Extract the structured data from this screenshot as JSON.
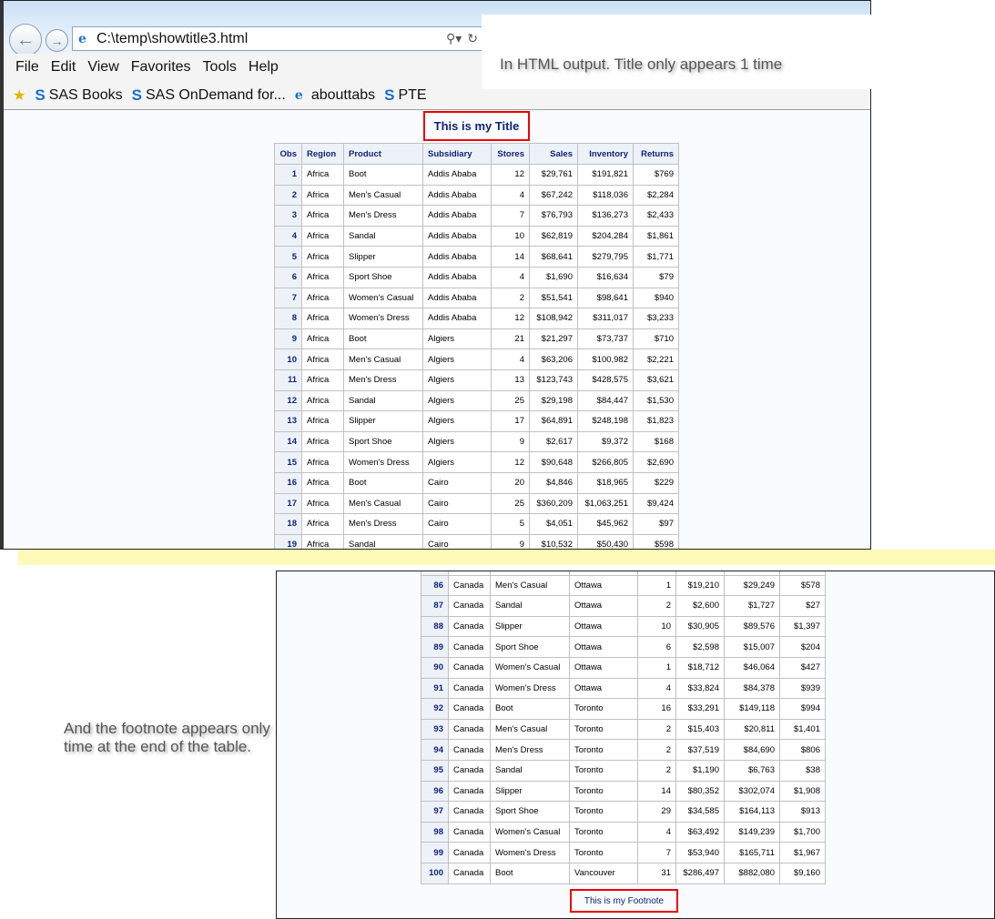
{
  "browser": {
    "address": "C:\\temp\\showtitle3.html",
    "menu": [
      "File",
      "Edit",
      "View",
      "Favorites",
      "Tools",
      "Help"
    ],
    "favorites": [
      {
        "icon": "sas-icon",
        "label": "SAS Books"
      },
      {
        "icon": "sas-icon",
        "label": "SAS OnDemand for..."
      },
      {
        "icon": "ie-page-icon",
        "label": "abouttabs"
      },
      {
        "icon": "sas-icon",
        "label": "PTE"
      }
    ]
  },
  "annotations": {
    "top": "In HTML output. Title only appears 1 time",
    "bottom": "And the footnote appears only 1 time at the end of the table."
  },
  "report": {
    "title": "This is my Title",
    "footnote": "This is my Footnote",
    "columns": [
      "Obs",
      "Region",
      "Product",
      "Subsidiary",
      "Stores",
      "Sales",
      "Inventory",
      "Returns"
    ],
    "rows_top": [
      [
        "1",
        "Africa",
        "Boot",
        "Addis Ababa",
        "12",
        "$29,761",
        "$191,821",
        "$769"
      ],
      [
        "2",
        "Africa",
        "Men's Casual",
        "Addis Ababa",
        "4",
        "$67,242",
        "$118,036",
        "$2,284"
      ],
      [
        "3",
        "Africa",
        "Men's Dress",
        "Addis Ababa",
        "7",
        "$76,793",
        "$136,273",
        "$2,433"
      ],
      [
        "4",
        "Africa",
        "Sandal",
        "Addis Ababa",
        "10",
        "$62,819",
        "$204,284",
        "$1,861"
      ],
      [
        "5",
        "Africa",
        "Slipper",
        "Addis Ababa",
        "14",
        "$68,641",
        "$279,795",
        "$1,771"
      ],
      [
        "6",
        "Africa",
        "Sport Shoe",
        "Addis Ababa",
        "4",
        "$1,690",
        "$16,634",
        "$79"
      ],
      [
        "7",
        "Africa",
        "Women's Casual",
        "Addis Ababa",
        "2",
        "$51,541",
        "$98,641",
        "$940"
      ],
      [
        "8",
        "Africa",
        "Women's Dress",
        "Addis Ababa",
        "12",
        "$108,942",
        "$311,017",
        "$3,233"
      ],
      [
        "9",
        "Africa",
        "Boot",
        "Algiers",
        "21",
        "$21,297",
        "$73,737",
        "$710"
      ],
      [
        "10",
        "Africa",
        "Men's Casual",
        "Algiers",
        "4",
        "$63,206",
        "$100,982",
        "$2,221"
      ],
      [
        "11",
        "Africa",
        "Men's Dress",
        "Algiers",
        "13",
        "$123,743",
        "$428,575",
        "$3,621"
      ],
      [
        "12",
        "Africa",
        "Sandal",
        "Algiers",
        "25",
        "$29,198",
        "$84,447",
        "$1,530"
      ],
      [
        "13",
        "Africa",
        "Slipper",
        "Algiers",
        "17",
        "$64,891",
        "$248,198",
        "$1,823"
      ],
      [
        "14",
        "Africa",
        "Sport Shoe",
        "Algiers",
        "9",
        "$2,617",
        "$9,372",
        "$168"
      ],
      [
        "15",
        "Africa",
        "Women's Dress",
        "Algiers",
        "12",
        "$90,648",
        "$266,805",
        "$2,690"
      ],
      [
        "16",
        "Africa",
        "Boot",
        "Cairo",
        "20",
        "$4,846",
        "$18,965",
        "$229"
      ],
      [
        "17",
        "Africa",
        "Men's Casual",
        "Cairo",
        "25",
        "$360,209",
        "$1,063,251",
        "$9,424"
      ],
      [
        "18",
        "Africa",
        "Men's Dress",
        "Cairo",
        "5",
        "$4,051",
        "$45,962",
        "$97"
      ],
      [
        "19",
        "Africa",
        "Sandal",
        "Cairo",
        "9",
        "$10,532",
        "$50,430",
        "$598"
      ]
    ],
    "rows_bottom": [
      [
        "86",
        "Canada",
        "Men's Casual",
        "Ottawa",
        "1",
        "$19,210",
        "$29,249",
        "$578"
      ],
      [
        "87",
        "Canada",
        "Sandal",
        "Ottawa",
        "2",
        "$2,600",
        "$1,727",
        "$27"
      ],
      [
        "88",
        "Canada",
        "Slipper",
        "Ottawa",
        "10",
        "$30,905",
        "$89,576",
        "$1,397"
      ],
      [
        "89",
        "Canada",
        "Sport Shoe",
        "Ottawa",
        "6",
        "$2,598",
        "$15,007",
        "$204"
      ],
      [
        "90",
        "Canada",
        "Women's Casual",
        "Ottawa",
        "1",
        "$18,712",
        "$46,064",
        "$427"
      ],
      [
        "91",
        "Canada",
        "Women's Dress",
        "Ottawa",
        "4",
        "$33,824",
        "$84,378",
        "$939"
      ],
      [
        "92",
        "Canada",
        "Boot",
        "Toronto",
        "16",
        "$33,291",
        "$149,118",
        "$994"
      ],
      [
        "93",
        "Canada",
        "Men's Casual",
        "Toronto",
        "2",
        "$15,403",
        "$20,811",
        "$1,401"
      ],
      [
        "94",
        "Canada",
        "Men's Dress",
        "Toronto",
        "2",
        "$37,519",
        "$84,690",
        "$806"
      ],
      [
        "95",
        "Canada",
        "Sandal",
        "Toronto",
        "2",
        "$1,190",
        "$6,763",
        "$38"
      ],
      [
        "96",
        "Canada",
        "Slipper",
        "Toronto",
        "14",
        "$80,352",
        "$302,074",
        "$1,908"
      ],
      [
        "97",
        "Canada",
        "Sport Shoe",
        "Toronto",
        "29",
        "$34,585",
        "$164,113",
        "$913"
      ],
      [
        "98",
        "Canada",
        "Women's Casual",
        "Toronto",
        "4",
        "$63,492",
        "$149,239",
        "$1,700"
      ],
      [
        "99",
        "Canada",
        "Women's Dress",
        "Toronto",
        "7",
        "$53,940",
        "$165,711",
        "$1,967"
      ],
      [
        "100",
        "Canada",
        "Boot",
        "Vancouver",
        "31",
        "$286,497",
        "$882,080",
        "$9,160"
      ]
    ]
  }
}
